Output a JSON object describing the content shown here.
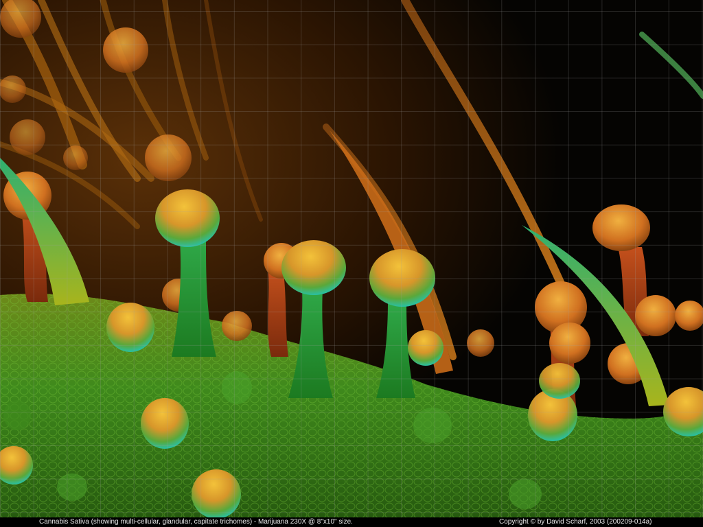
{
  "caption": {
    "left": "Cannabis Sativa (showing multi-cellular, glandular, capitate trichomes) - Marijuana   230X @ 8\"x10\" size.",
    "right": "Copyright © by David Scharf, 2003   (200209-014a)"
  },
  "colors": {
    "background": "#050402",
    "grid": "#a0a0a0",
    "leaf_green": "#3f8a1c",
    "trichome_orange": "#e0801c",
    "cap_cyan": "#1ad0d0"
  }
}
